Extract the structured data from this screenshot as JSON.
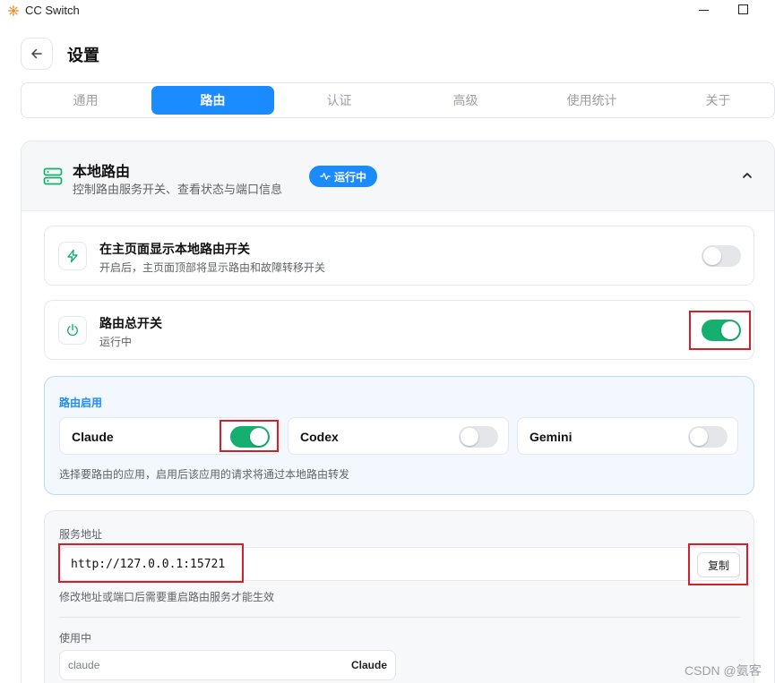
{
  "window": {
    "title": "CC Switch"
  },
  "header": {
    "title": "设置"
  },
  "tabs": [
    {
      "label": "通用"
    },
    {
      "label": "路由"
    },
    {
      "label": "认证"
    },
    {
      "label": "高级"
    },
    {
      "label": "使用统计"
    },
    {
      "label": "关于"
    }
  ],
  "active_tab": "路由",
  "section": {
    "title": "本地路由",
    "subtitle": "控制路由服务开关、查看状态与端口信息",
    "status_badge": "运行中",
    "expanded": true
  },
  "settings": {
    "show_on_home": {
      "title": "在主页面显示本地路由开关",
      "subtitle": "开启后，主页面顶部将显示路由和故障转移开关",
      "enabled": false
    },
    "master_switch": {
      "title": "路由总开关",
      "subtitle": "运行中",
      "enabled": true
    }
  },
  "route_apps": {
    "label": "路由启用",
    "apps": [
      {
        "name": "Claude",
        "enabled": true
      },
      {
        "name": "Codex",
        "enabled": false
      },
      {
        "name": "Gemini",
        "enabled": false
      }
    ],
    "hint": "选择要路由的应用，启用后该应用的请求将通过本地路由转发"
  },
  "service": {
    "label": "服务地址",
    "address": "http://127.0.0.1:15721",
    "copy_label": "复制",
    "hint": "修改地址或端口后需要重启路由服务才能生效",
    "in_use_label": "使用中",
    "in_use_placeholder": "claude",
    "in_use_value": "Claude"
  },
  "watermark": "CSDN @氨客",
  "colors": {
    "accent": "#1a8cff",
    "toggle_on": "#15b06f",
    "highlight": "#d51f2c"
  }
}
